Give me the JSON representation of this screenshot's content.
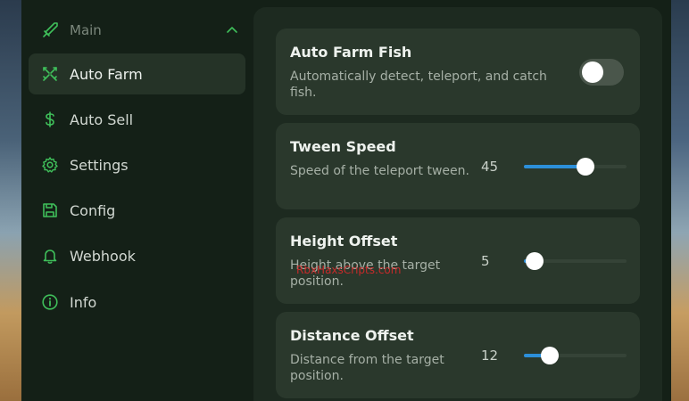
{
  "sidebar": {
    "section": {
      "label": "Main",
      "icon": "sword-icon",
      "expand_icon": "chevron-up-icon"
    },
    "items": [
      {
        "label": "Auto Farm",
        "icon": "crossed-swords-icon",
        "active": true
      },
      {
        "label": "Auto Sell",
        "icon": "dollar-icon",
        "active": false
      },
      {
        "label": "Settings",
        "icon": "gear-icon",
        "active": false
      },
      {
        "label": "Config",
        "icon": "save-icon",
        "active": false
      },
      {
        "label": "Webhook",
        "icon": "bell-icon",
        "active": false
      },
      {
        "label": "Info",
        "icon": "info-icon",
        "active": false
      }
    ]
  },
  "main": {
    "cards": [
      {
        "title": "Auto Farm Fish",
        "description": "Automatically detect, teleport, and catch fish.",
        "control": "toggle",
        "enabled": false
      },
      {
        "title": "Tween Speed",
        "description": "Speed of the teleport tween.",
        "control": "slider",
        "value": "45",
        "level": 0.6
      },
      {
        "title": "Height Offset",
        "description": "Height above the target position.",
        "control": "slider",
        "value": "5",
        "level": 0.1
      },
      {
        "title": "Distance Offset",
        "description": "Distance from the target position.",
        "control": "slider",
        "value": "12",
        "level": 0.25
      }
    ]
  },
  "watermark": "RbxHaxsCripts.com",
  "colors": {
    "accent": "#2c8fd9",
    "icon_green": "#3fbf5a",
    "window_bg": "#142017",
    "card_bg": "#2a382c"
  }
}
